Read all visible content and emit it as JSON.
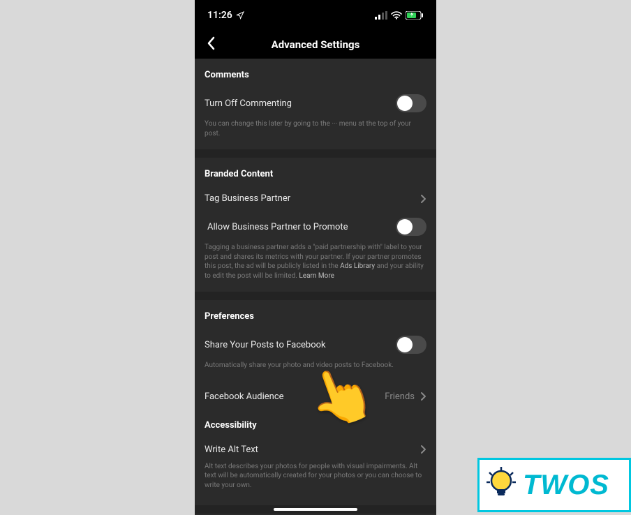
{
  "status": {
    "time": "11:26"
  },
  "nav": {
    "title": "Advanced Settings"
  },
  "comments": {
    "header": "Comments",
    "toggle_label": "Turn Off Commenting",
    "helper": "You can change this later by going to the ··· menu at the top of your post."
  },
  "branded": {
    "header": "Branded Content",
    "tag_partner": "Tag Business Partner",
    "allow_promote": "Allow Business Partner to Promote",
    "helper_a": "Tagging a business partner adds a \"paid partnership with\" label to your post and shares its metrics with your partner. If your partner promotes this post, the ad will be publicly listed in the ",
    "ads_library": "Ads Library",
    "helper_b": " and your ability to edit the post will be limited. ",
    "learn_more": "Learn More"
  },
  "prefs": {
    "header": "Preferences",
    "share_label": "Share Your Posts to Facebook",
    "share_helper": "Automatically share your photo and video posts to Facebook.",
    "audience_label": "Facebook Audience",
    "audience_value": "Friends"
  },
  "accessibility": {
    "header": "Accessibility",
    "alt_label": "Write Alt Text",
    "alt_helper": "Alt text describes your photos for people with visual impairments. Alt text will be automatically created for your photos or you can choose to write your own."
  },
  "badge": {
    "text": "TWOS"
  }
}
